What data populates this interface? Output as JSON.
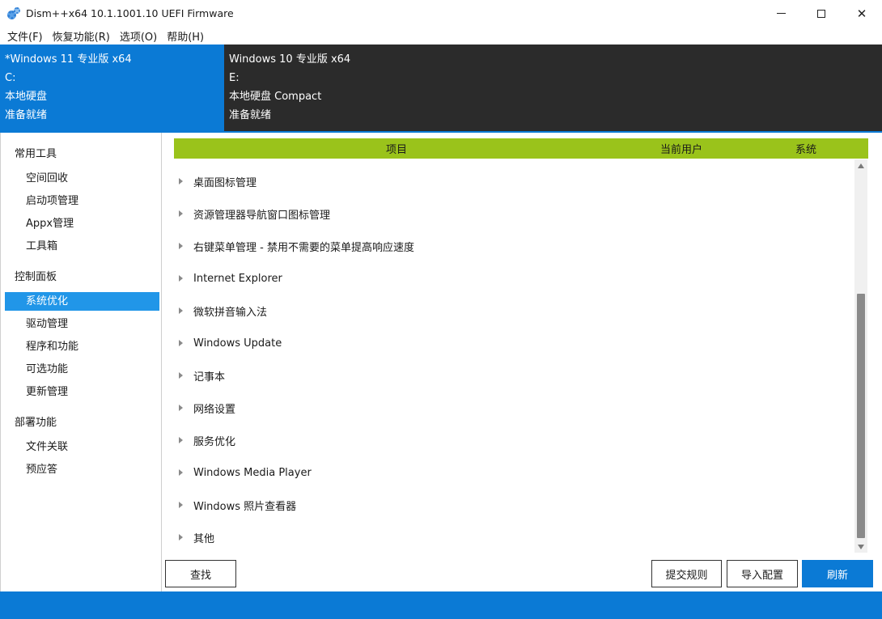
{
  "window": {
    "title": "Dism++x64 10.1.1001.10 UEFI Firmware",
    "icon": "gears-icon"
  },
  "menu": [
    {
      "label": "文件(F)"
    },
    {
      "label": "恢复功能(R)"
    },
    {
      "label": "选项(O)"
    },
    {
      "label": "帮助(H)"
    }
  ],
  "images": [
    {
      "name": "*Windows 11 专业版 x64",
      "drive": "C:",
      "type": "本地硬盘",
      "status": "准备就绪",
      "active": true
    },
    {
      "name": "Windows 10 专业版 x64",
      "drive": "E:",
      "type": "本地硬盘 Compact",
      "status": "准备就绪",
      "active": false
    }
  ],
  "sidebar": {
    "groups": [
      {
        "label": "常用工具",
        "items": [
          "空间回收",
          "启动项管理",
          "Appx管理",
          "工具箱"
        ]
      },
      {
        "label": "控制面板",
        "items": [
          "系统优化",
          "驱动管理",
          "程序和功能",
          "可选功能",
          "更新管理"
        ]
      },
      {
        "label": "部署功能",
        "items": [
          "文件关联",
          "预应答"
        ]
      }
    ],
    "selected": "系统优化"
  },
  "table": {
    "columns": [
      "项目",
      "当前用户",
      "系统"
    ],
    "rows": [
      "桌面图标管理",
      "资源管理器导航窗口图标管理",
      "右键菜单管理 - 禁用不需要的菜单提高响应速度",
      "Internet Explorer",
      "微软拼音输入法",
      "Windows Update",
      "记事本",
      "网络设置",
      "服务优化",
      "Windows Media Player",
      "Windows 照片查看器",
      "其他"
    ]
  },
  "buttons": {
    "find": "查找",
    "submit_rules": "提交规则",
    "import_config": "导入配置",
    "refresh": "刷新"
  },
  "colors": {
    "accent": "#0b7ad5",
    "header_green": "#9ac31b",
    "inactive_image_bg": "#2b2b2b",
    "selected_nav": "#2196e8"
  }
}
